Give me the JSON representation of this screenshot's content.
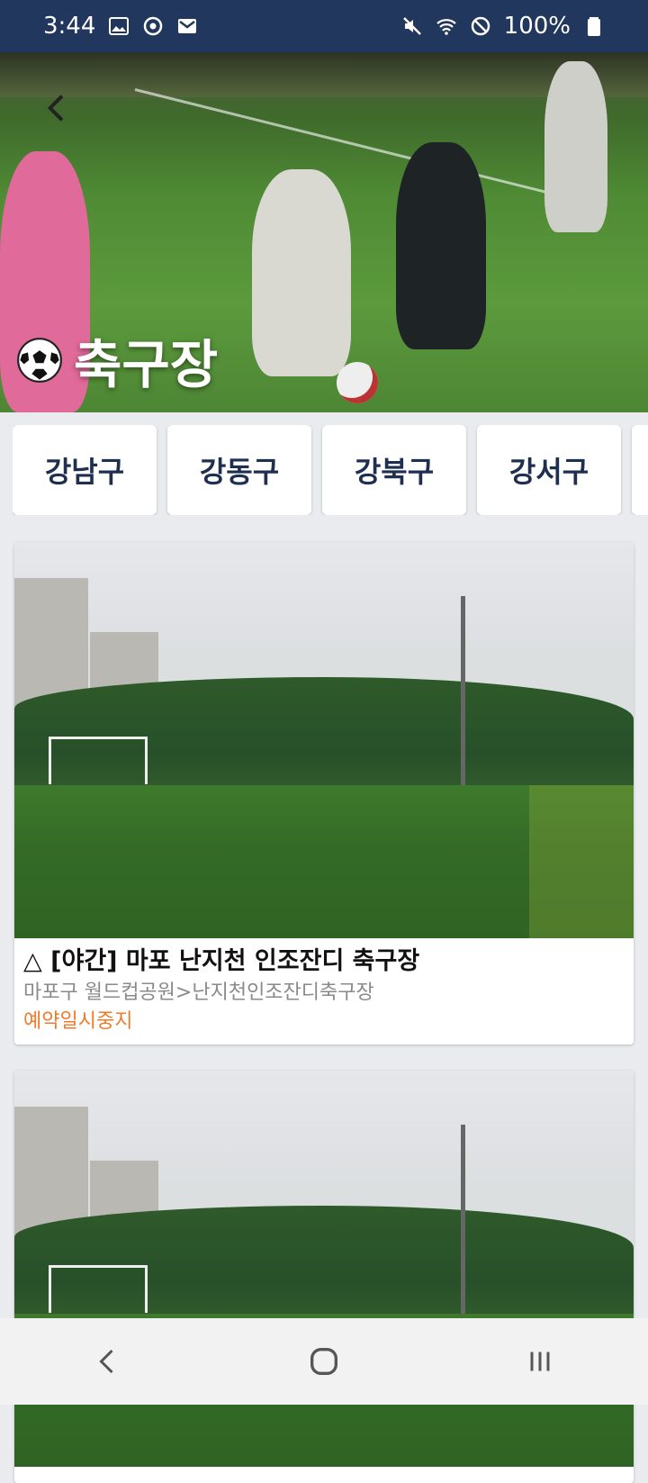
{
  "status_bar": {
    "time": "3:44",
    "battery": "100%",
    "left_icons": [
      "image-icon",
      "sync-icon",
      "gmail-icon"
    ],
    "right_icons": [
      "mute-icon",
      "wifi-icon",
      "block-icon",
      "battery-icon"
    ]
  },
  "hero": {
    "title": "축구장",
    "icon": "soccer-ball-icon"
  },
  "districts": [
    "강남구",
    "강동구",
    "강북구",
    "강서구",
    ""
  ],
  "cards": [
    {
      "title": "△ [야간] 마포 난지천 인조잔디 축구장",
      "location": "마포구 월드컵공원>난지천인조잔디축구장",
      "status": "예약일시중지"
    },
    {
      "title": "",
      "location": "",
      "status": ""
    }
  ],
  "colors": {
    "status_bar": "#22375e",
    "chip_text": "#1f2f4f",
    "status_orange": "#ee7b2c"
  }
}
